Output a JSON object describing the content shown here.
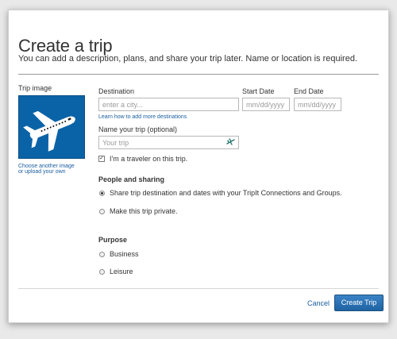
{
  "dialog": {
    "title": "Create a trip",
    "subtitle": "You can add a description, plans, and share your trip later. Name or location is required."
  },
  "trip_image": {
    "label": "Trip image",
    "change_link_line1": "Choose another image",
    "change_link_line2": "or upload your own",
    "icon": "airplane-icon",
    "background_color": "#0b63a7"
  },
  "destination": {
    "label": "Destination",
    "placeholder": "enter a city...",
    "help_link": "Learn how to add more destinations"
  },
  "start_date": {
    "label": "Start Date",
    "placeholder": "mm/dd/yyyy"
  },
  "end_date": {
    "label": "End Date",
    "placeholder": "mm/dd/yyyy"
  },
  "trip_name": {
    "label": "Name your trip (optional)",
    "placeholder": "Your trip",
    "icon": "airplane-icon"
  },
  "traveler_checkbox": {
    "label": "I'm a traveler on this trip.",
    "checked": true
  },
  "sharing": {
    "heading": "People and sharing",
    "options": [
      {
        "label": "Share trip destination and dates with your TripIt Connections and Groups.",
        "selected": true
      },
      {
        "label": "Make this trip private.",
        "selected": false
      }
    ]
  },
  "purpose": {
    "heading": "Purpose",
    "options": [
      {
        "label": "Business",
        "selected": false
      },
      {
        "label": "Leisure",
        "selected": false
      }
    ]
  },
  "actions": {
    "cancel_label": "Cancel",
    "create_label": "Create Trip",
    "accent_color": "#2a73b8"
  }
}
